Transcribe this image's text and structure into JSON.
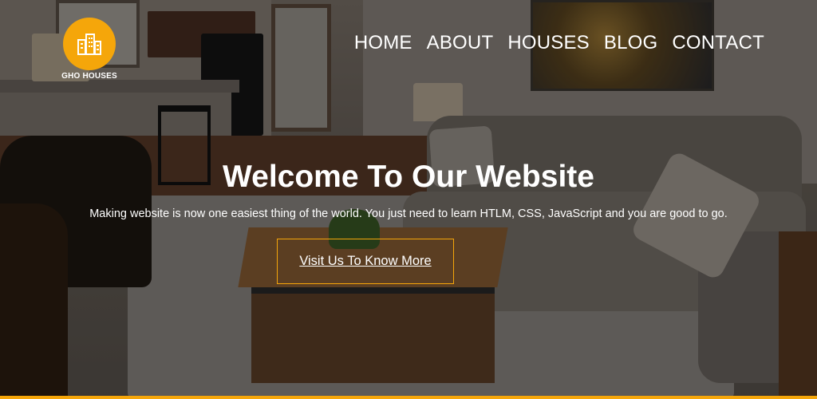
{
  "brand": {
    "name": "GHO HOUSES",
    "logo_icon": "building-icon",
    "accent_color": "#f5a60a"
  },
  "nav": {
    "items": [
      {
        "label": "HOME"
      },
      {
        "label": "ABOUT"
      },
      {
        "label": "HOUSES"
      },
      {
        "label": "BLOG"
      },
      {
        "label": "CONTACT"
      }
    ]
  },
  "hero": {
    "title": "Welcome To Our Website",
    "subtitle": "Making website is now one easiest thing of the world. You just need to learn HTLM, CSS, JavaScript and you are good to go.",
    "cta_label": "Visit Us To Know More"
  }
}
